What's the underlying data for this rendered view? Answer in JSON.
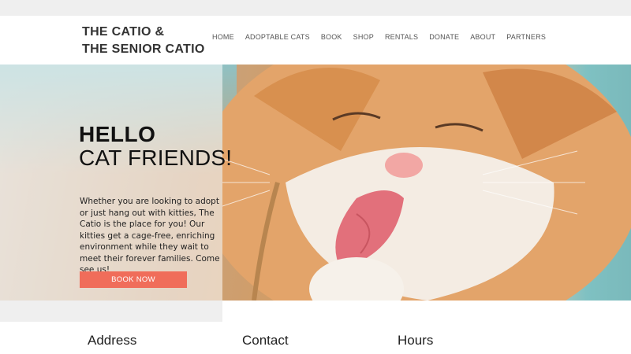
{
  "brand": {
    "line1": "THE CATIO &",
    "line2": "THE SENIOR CATIO"
  },
  "nav": {
    "items": [
      "HOME",
      "ADOPTABLE CATS",
      "BOOK",
      "SHOP",
      "RENTALS",
      "DONATE",
      "ABOUT",
      "PARTNERS"
    ]
  },
  "hero": {
    "title_line1": "HELLO",
    "title_line2": "CAT FRIENDS!",
    "text": "Whether you are looking to adopt or just hang out with kitties,  The Catio is the place for you! Our kitties get a cage-free, enriching environment while they wait to meet their forever families. Come see us!",
    "button_label": "BOOK NOW",
    "image_icon": "cat-photo-icon"
  },
  "footer": {
    "address": "Address",
    "contact": "Contact",
    "hours": "Hours"
  },
  "colors": {
    "accent": "#f06d5a",
    "nav_text": "#555555",
    "teal": "#7fc1c2"
  }
}
